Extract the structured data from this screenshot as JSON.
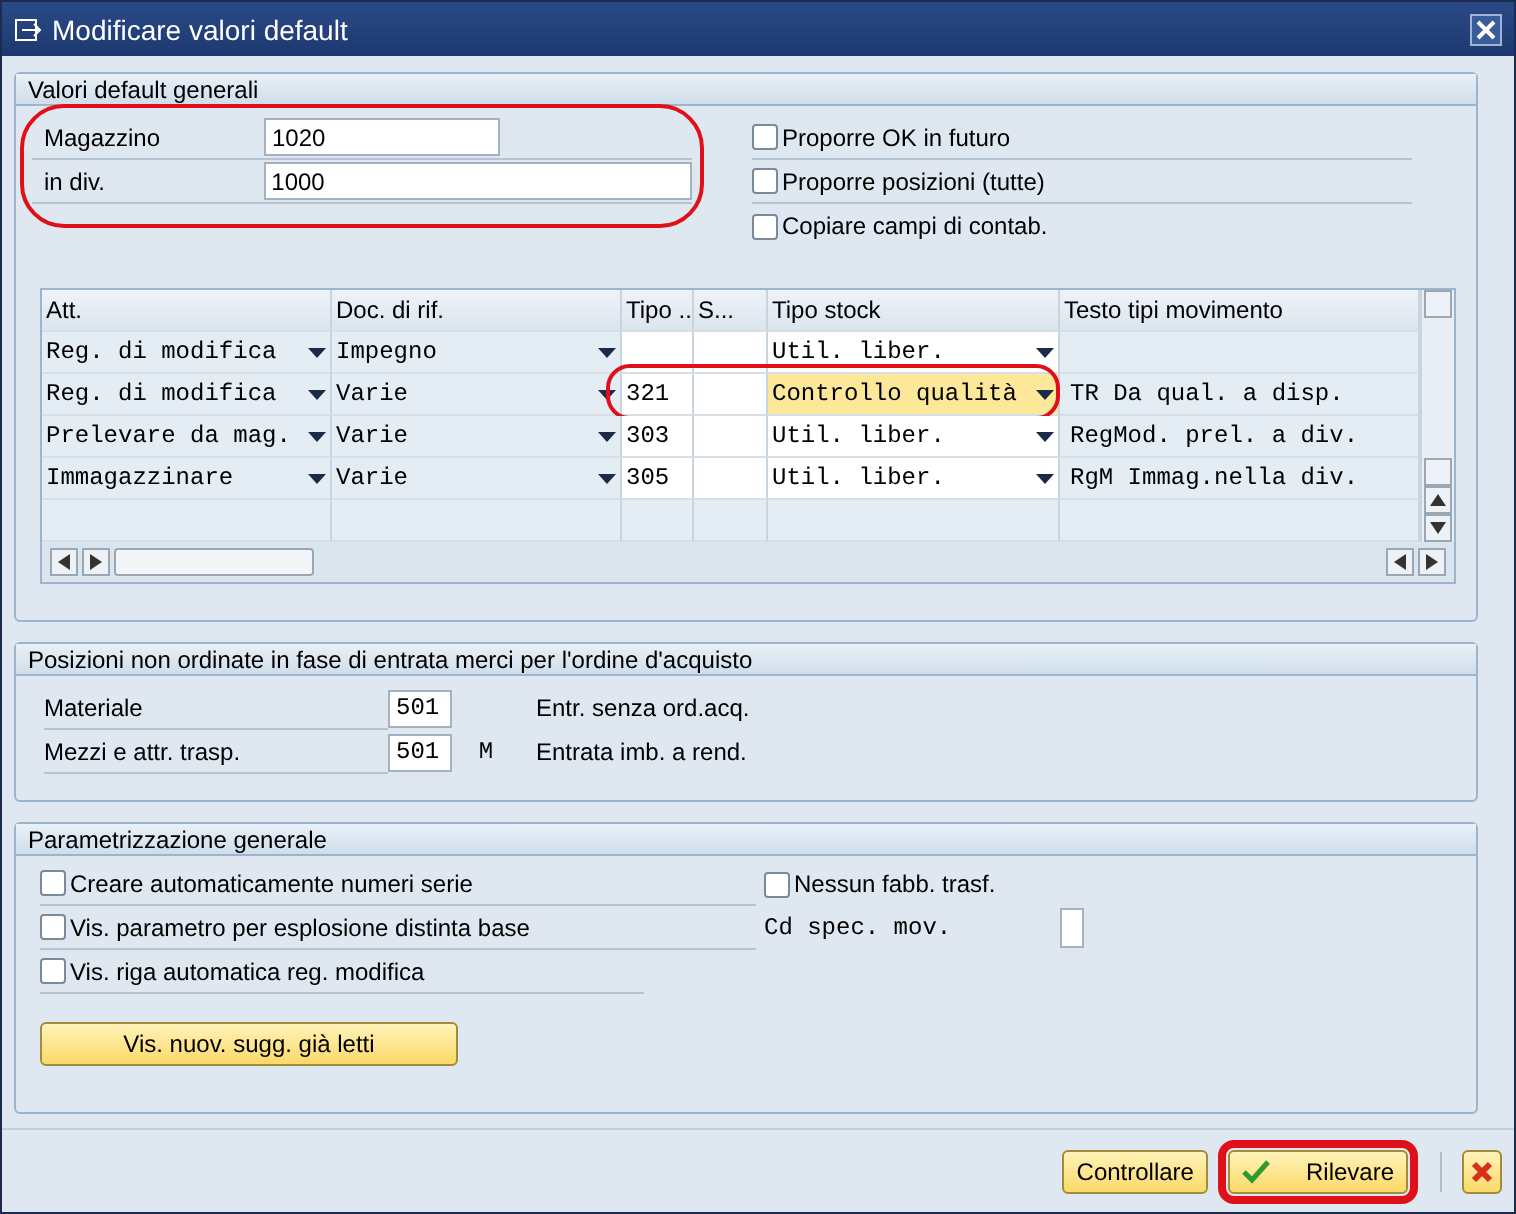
{
  "window": {
    "title": "Modificare valori default"
  },
  "general": {
    "title": "Valori default generali",
    "highlighted": true,
    "fields": [
      {
        "label": "Magazzino",
        "value": "1020"
      },
      {
        "label": "in div.",
        "value": "1000"
      }
    ],
    "options": [
      {
        "label": "Proporre OK in futuro",
        "checked": false
      },
      {
        "label": "Proporre posizioni (tutte)",
        "checked": false
      },
      {
        "label": "Copiare campi di contab.",
        "checked": false
      }
    ]
  },
  "table": {
    "columns": [
      "Att.",
      "Doc. di rif.",
      "Tipo ...",
      "S...",
      "Tipo stock",
      "Testo tipi movimento"
    ],
    "rows": [
      {
        "activity": "Reg. di modifica",
        "reference": "Impegno",
        "type": "",
        "special": "",
        "stock": "Util. liber.",
        "text": "",
        "highlighted": false
      },
      {
        "activity": "Reg. di modifica",
        "reference": "Varie",
        "type": "321",
        "special": "",
        "stock": "Controllo qualità",
        "text": "TR Da qual. a disp.",
        "highlighted": true
      },
      {
        "activity": "Prelevare da mag.",
        "reference": "Varie",
        "type": "303",
        "special": "",
        "stock": "Util. liber.",
        "text": "RegMod. prel. a div.",
        "highlighted": false
      },
      {
        "activity": "Immagazzinare",
        "reference": "Varie",
        "type": "305",
        "special": "",
        "stock": "Util. liber.",
        "text": "RgM Immag.nella div.",
        "highlighted": false
      }
    ]
  },
  "unordered": {
    "title": "Posizioni non ordinate in fase di entrata merci per l'ordine d'acquisto",
    "rows": [
      {
        "label": "Materiale",
        "value": "501",
        "flag": "",
        "text": "Entr. senza ord.acq."
      },
      {
        "label": "Mezzi e attr. trasp.",
        "value": "501",
        "flag": "M",
        "text": "Entrata imb. a rend."
      }
    ]
  },
  "settings": {
    "title": "Parametrizzazione generale",
    "options": [
      {
        "label": "Creare automaticamente numeri serie",
        "checked": false
      },
      {
        "label": "Vis. parametro per esplosione distinta base",
        "checked": false
      },
      {
        "label": "Vis. riga automatica reg. modifica",
        "checked": false
      }
    ],
    "side_option": {
      "label": "Nessun fabb. trasf.",
      "checked": false
    },
    "side_field": {
      "label": "Cd spec. mov."
    },
    "button": "Vis. nuov. sugg. già letti"
  },
  "footer": [
    {
      "kind": "text",
      "label": "Controllare",
      "highlighted": false
    },
    {
      "kind": "check",
      "label": "Rilevare",
      "highlighted": true
    },
    {
      "kind": "cancel",
      "highlighted": false
    }
  ]
}
